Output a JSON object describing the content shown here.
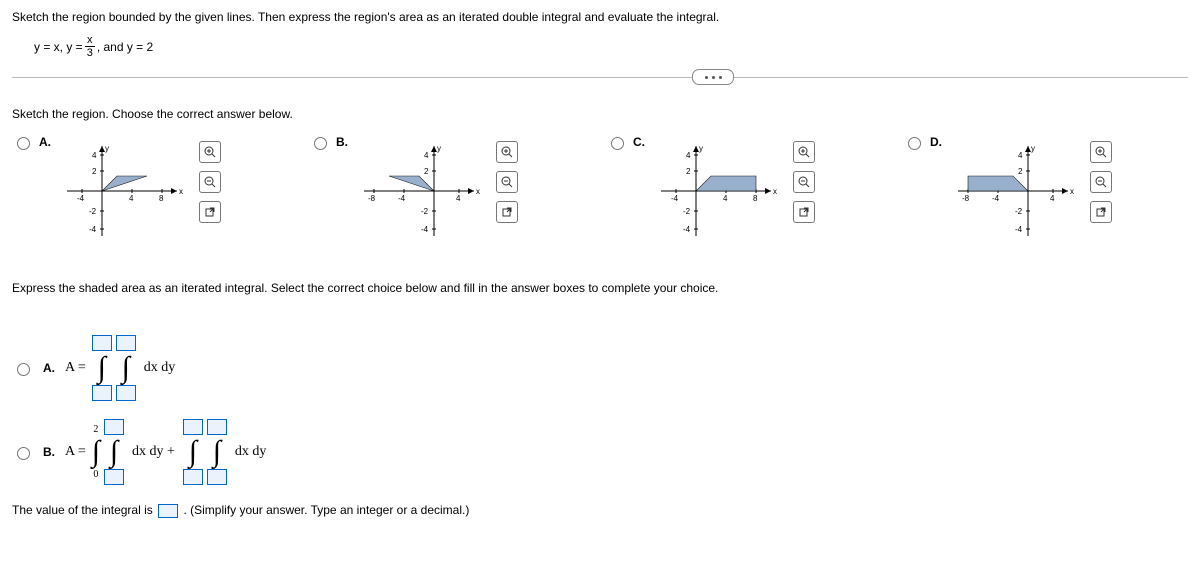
{
  "question": {
    "intro": "Sketch the region bounded by the given lines. Then express the region's area as an iterated double integral and evaluate the integral.",
    "equation_pre": "y = x, y = ",
    "frac_num": "x",
    "frac_den": "3",
    "equation_post": ", and y = 2"
  },
  "part1": {
    "prompt": "Sketch the region. Choose the correct answer below.",
    "labels": {
      "A": "A.",
      "B": "B.",
      "C": "C.",
      "D": "D."
    }
  },
  "part2": {
    "prompt": "Express the shaded area as an iterated integral. Select the correct choice below and fill in the answer boxes to complete your choice.",
    "optA_label": "A.",
    "optA_eq": "A =",
    "optA_diff": "dx dy",
    "optB_label": "B.",
    "optB_eq": "A =",
    "optB_low1": "0",
    "optB_up1": "2",
    "optB_diff1": "dx dy +",
    "optB_diff2": "dx dy"
  },
  "final": {
    "pre": "The value of the integral is ",
    "post": ". (Simplify your answer. Type an integer or a decimal.)"
  },
  "axis": {
    "x_label": "x",
    "y_label": "y"
  },
  "ticks": {
    "neg4": "-4",
    "neg8": "-8",
    "p4": "4",
    "p8": "8",
    "y2": "2",
    "y4": "4",
    "ym2": "-2",
    "ym4": "-4"
  }
}
